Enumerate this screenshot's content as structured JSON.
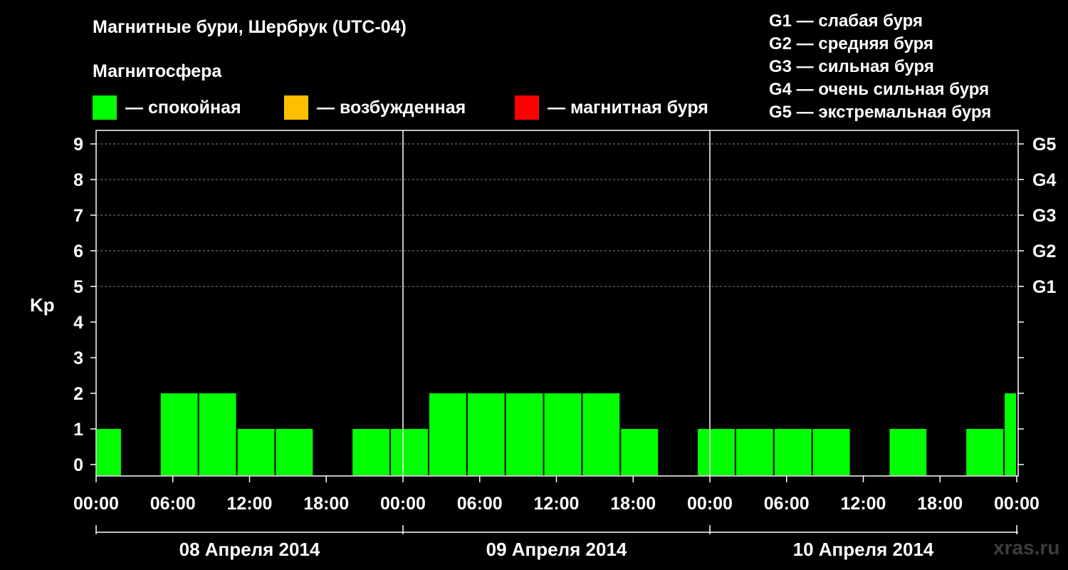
{
  "title": "Магнитные бури, Шербрук (UTC-04)",
  "subtitle": "Магнитосфера",
  "legend": [
    {
      "color": "#00ff00",
      "label": "— спокойная"
    },
    {
      "color": "#ffbf00",
      "label": "— возбужденная"
    },
    {
      "color": "#ff0000",
      "label": "— магнитная буря"
    }
  ],
  "g_legend": [
    "G1 — слабая буря",
    "G2 — средняя буря",
    "G3 — сильная буря",
    "G4 — очень сильная буря",
    "G5 — экстремальная буря"
  ],
  "watermark": "xras.ru",
  "chart_data": {
    "type": "bar",
    "ylabel": "Kp",
    "ylim": [
      0,
      9
    ],
    "y_ticks": [
      "0",
      "1",
      "2",
      "3",
      "4",
      "5",
      "6",
      "7",
      "8",
      "9"
    ],
    "g_levels": [
      {
        "label": "G1",
        "kp": 5
      },
      {
        "label": "G2",
        "kp": 6
      },
      {
        "label": "G3",
        "kp": 7
      },
      {
        "label": "G4",
        "kp": 8
      },
      {
        "label": "G5",
        "kp": 9
      }
    ],
    "x_unit": "hours from 08 Апреля 2014 00:00 local time",
    "x_ticks": [
      "00:00",
      "06:00",
      "12:00",
      "18:00",
      "00:00",
      "06:00",
      "12:00",
      "18:00",
      "00:00",
      "06:00",
      "12:00",
      "18:00",
      "00:00"
    ],
    "days": [
      "08 Апреля 2014",
      "09 Апреля 2014",
      "10 Апреля 2014"
    ],
    "bar_color": "#00ff00",
    "bars": [
      {
        "start": 0,
        "end": 2,
        "kp": 1
      },
      {
        "start": 5,
        "end": 8,
        "kp": 2
      },
      {
        "start": 8,
        "end": 11,
        "kp": 2
      },
      {
        "start": 11,
        "end": 14,
        "kp": 1
      },
      {
        "start": 14,
        "end": 17,
        "kp": 1
      },
      {
        "start": 20,
        "end": 23,
        "kp": 1
      },
      {
        "start": 23,
        "end": 26,
        "kp": 1
      },
      {
        "start": 26,
        "end": 29,
        "kp": 2
      },
      {
        "start": 29,
        "end": 32,
        "kp": 2
      },
      {
        "start": 32,
        "end": 35,
        "kp": 2
      },
      {
        "start": 35,
        "end": 38,
        "kp": 2
      },
      {
        "start": 38,
        "end": 41,
        "kp": 2
      },
      {
        "start": 41,
        "end": 44,
        "kp": 1
      },
      {
        "start": 47,
        "end": 50,
        "kp": 1
      },
      {
        "start": 50,
        "end": 53,
        "kp": 1
      },
      {
        "start": 53,
        "end": 56,
        "kp": 1
      },
      {
        "start": 56,
        "end": 59,
        "kp": 1
      },
      {
        "start": 62,
        "end": 65,
        "kp": 1
      },
      {
        "start": 68,
        "end": 71,
        "kp": 1
      },
      {
        "start": 71,
        "end": 72,
        "kp": 2
      }
    ]
  }
}
